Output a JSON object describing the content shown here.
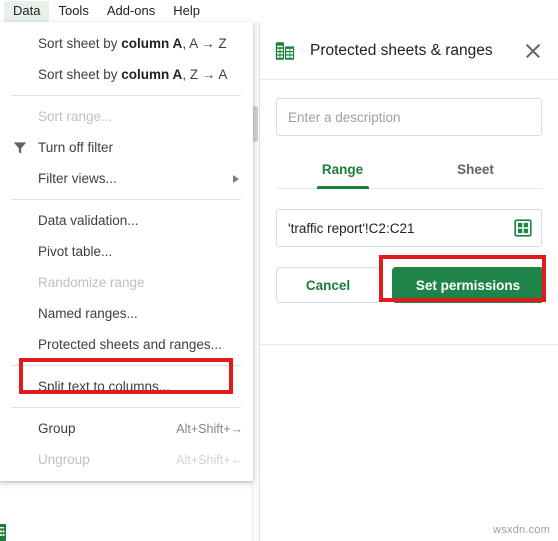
{
  "menubar": {
    "items": [
      {
        "label": "Data",
        "active": true
      },
      {
        "label": "Tools",
        "active": false
      },
      {
        "label": "Add-ons",
        "active": false
      },
      {
        "label": "Help",
        "active": false
      }
    ]
  },
  "data_menu": {
    "items": [
      {
        "label_html": "Sort sheet by <b>column A</b>, A → Z",
        "plain": "Sort sheet by column A, A → Z",
        "disabled": false,
        "icon": "",
        "accel": "",
        "submenu": false
      },
      {
        "label_html": "Sort sheet by <b>column A</b>, Z → A",
        "plain": "Sort sheet by column A, Z → A",
        "disabled": false,
        "icon": "",
        "accel": "",
        "submenu": false
      },
      {
        "separator": true
      },
      {
        "label_html": "Sort range...",
        "plain": "Sort range...",
        "disabled": true,
        "icon": "",
        "accel": "",
        "submenu": false
      },
      {
        "label_html": "Turn off filter",
        "plain": "Turn off filter",
        "disabled": false,
        "icon": "filter-icon",
        "accel": "",
        "submenu": false
      },
      {
        "label_html": "Filter views...",
        "plain": "Filter views...",
        "disabled": false,
        "icon": "",
        "accel": "",
        "submenu": true
      },
      {
        "separator": true
      },
      {
        "label_html": "Data validation...",
        "plain": "Data validation...",
        "disabled": false,
        "icon": "",
        "accel": "",
        "submenu": false
      },
      {
        "label_html": "Pivot table...",
        "plain": "Pivot table...",
        "disabled": false,
        "icon": "",
        "accel": "",
        "submenu": false
      },
      {
        "label_html": "Randomize range",
        "plain": "Randomize range",
        "disabled": true,
        "icon": "",
        "accel": "",
        "submenu": false
      },
      {
        "label_html": "Named ranges...",
        "plain": "Named ranges...",
        "disabled": false,
        "icon": "",
        "accel": "",
        "submenu": false
      },
      {
        "label_html": "Protected sheets and ranges...",
        "plain": "Protected sheets and ranges...",
        "disabled": false,
        "icon": "",
        "accel": "",
        "submenu": false,
        "highlighted": true
      },
      {
        "separator": true
      },
      {
        "label_html": "Split text to columns...",
        "plain": "Split text to columns...",
        "disabled": false,
        "icon": "",
        "accel": "",
        "submenu": false
      },
      {
        "separator": true
      },
      {
        "label_html": "Group",
        "plain": "Group",
        "disabled": false,
        "icon": "",
        "accel": "Alt+Shift+→",
        "submenu": false
      },
      {
        "label_html": "Ungroup",
        "plain": "Ungroup",
        "disabled": true,
        "icon": "",
        "accel": "Alt+Shift+←",
        "submenu": false
      }
    ]
  },
  "side_panel": {
    "title": "Protected sheets & ranges",
    "sheet_icon": "sheets-icon",
    "close_icon": "close-icon",
    "description": {
      "value": "",
      "placeholder": "Enter a description"
    },
    "tabs": [
      {
        "label": "Range",
        "selected": true
      },
      {
        "label": "Sheet",
        "selected": false
      }
    ],
    "range": {
      "value": "'traffic report'!C2:C21",
      "picker_icon": "range-picker-icon"
    },
    "buttons": {
      "cancel": "Cancel",
      "set_permissions": "Set permissions"
    }
  },
  "annotations": {
    "highlight_color": "#e01b1b",
    "boxes": [
      {
        "name": "protected-sheets-menu-highlight",
        "target": "Protected sheets and ranges..."
      },
      {
        "name": "set-permissions-button-highlight",
        "target": "Set permissions"
      }
    ]
  },
  "watermark": {
    "text": "wsxdn.com"
  },
  "colors": {
    "brand_green": "#1e8449",
    "tab_green": "#188038",
    "menu_text": "#3c4043",
    "disabled_text": "#bdc1c6",
    "border": "#dadce0",
    "annotation_red": "#e01b1b"
  }
}
